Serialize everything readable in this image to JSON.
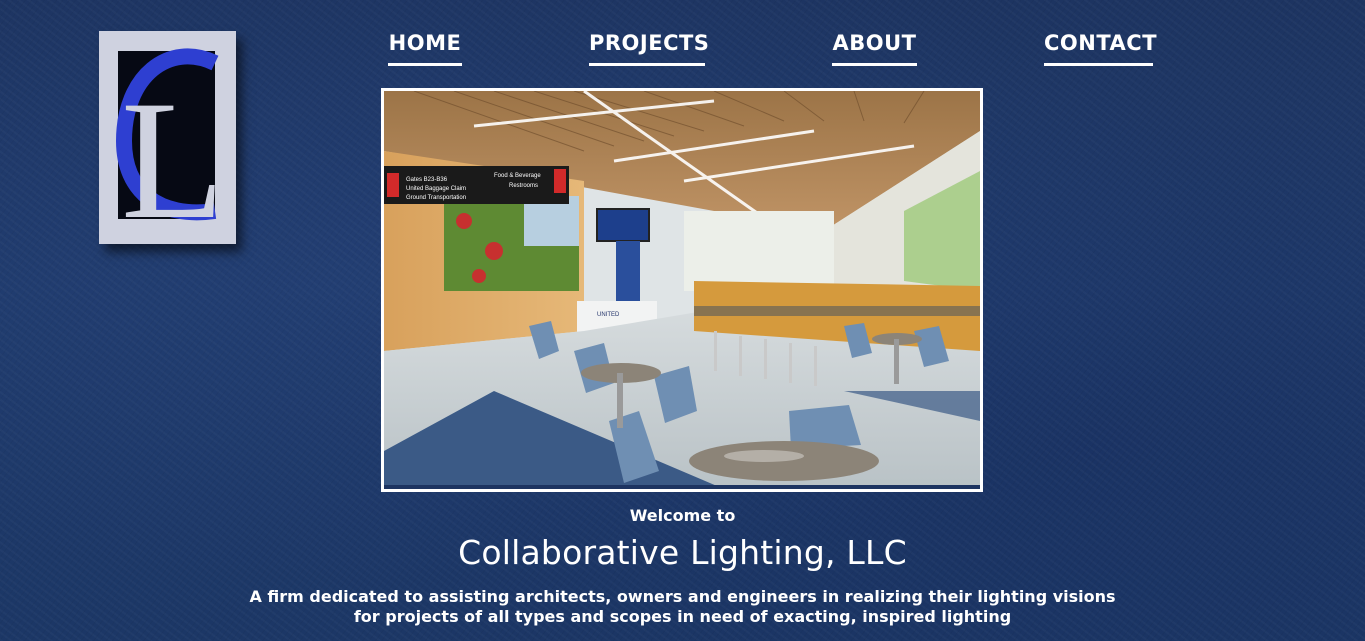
{
  "logo": {
    "letter": "L",
    "accent_color": "#2e3fd1",
    "frame_color": "#cfd2e0"
  },
  "nav": {
    "items": [
      {
        "label": "HOME"
      },
      {
        "label": "PROJECTS"
      },
      {
        "label": "ABOUT"
      },
      {
        "label": "CONTACT"
      }
    ]
  },
  "hero": {
    "signs": {
      "left_line1": "Gates B23-B36",
      "left_line2": "United Baggage Claim",
      "left_line3": "Ground Transportation",
      "right_line1": "Food & Beverage",
      "right_line2": "Restrooms"
    },
    "kiosk_text": "UNITED"
  },
  "intro": {
    "welcome": "Welcome to",
    "title": "Collaborative Lighting, LLC",
    "tagline_line1": "A firm dedicated to assisting architects, owners and engineers in realizing their lighting visions",
    "tagline_line2": "for projects of all types and scopes in need of exacting, inspired lighting"
  },
  "colors": {
    "background": "#1f3a6b",
    "text": "#ffffff"
  }
}
